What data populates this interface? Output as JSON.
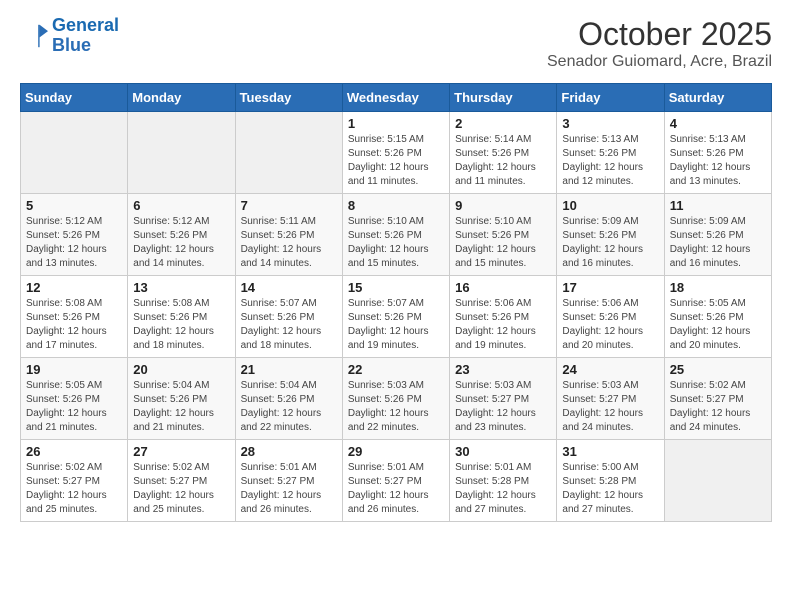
{
  "header": {
    "logo_line1": "General",
    "logo_line2": "Blue",
    "month": "October 2025",
    "location": "Senador Guiomard, Acre, Brazil"
  },
  "weekdays": [
    "Sunday",
    "Monday",
    "Tuesday",
    "Wednesday",
    "Thursday",
    "Friday",
    "Saturday"
  ],
  "weeks": [
    [
      {
        "day": "",
        "info": ""
      },
      {
        "day": "",
        "info": ""
      },
      {
        "day": "",
        "info": ""
      },
      {
        "day": "1",
        "info": "Sunrise: 5:15 AM\nSunset: 5:26 PM\nDaylight: 12 hours\nand 11 minutes."
      },
      {
        "day": "2",
        "info": "Sunrise: 5:14 AM\nSunset: 5:26 PM\nDaylight: 12 hours\nand 11 minutes."
      },
      {
        "day": "3",
        "info": "Sunrise: 5:13 AM\nSunset: 5:26 PM\nDaylight: 12 hours\nand 12 minutes."
      },
      {
        "day": "4",
        "info": "Sunrise: 5:13 AM\nSunset: 5:26 PM\nDaylight: 12 hours\nand 13 minutes."
      }
    ],
    [
      {
        "day": "5",
        "info": "Sunrise: 5:12 AM\nSunset: 5:26 PM\nDaylight: 12 hours\nand 13 minutes."
      },
      {
        "day": "6",
        "info": "Sunrise: 5:12 AM\nSunset: 5:26 PM\nDaylight: 12 hours\nand 14 minutes."
      },
      {
        "day": "7",
        "info": "Sunrise: 5:11 AM\nSunset: 5:26 PM\nDaylight: 12 hours\nand 14 minutes."
      },
      {
        "day": "8",
        "info": "Sunrise: 5:10 AM\nSunset: 5:26 PM\nDaylight: 12 hours\nand 15 minutes."
      },
      {
        "day": "9",
        "info": "Sunrise: 5:10 AM\nSunset: 5:26 PM\nDaylight: 12 hours\nand 15 minutes."
      },
      {
        "day": "10",
        "info": "Sunrise: 5:09 AM\nSunset: 5:26 PM\nDaylight: 12 hours\nand 16 minutes."
      },
      {
        "day": "11",
        "info": "Sunrise: 5:09 AM\nSunset: 5:26 PM\nDaylight: 12 hours\nand 16 minutes."
      }
    ],
    [
      {
        "day": "12",
        "info": "Sunrise: 5:08 AM\nSunset: 5:26 PM\nDaylight: 12 hours\nand 17 minutes."
      },
      {
        "day": "13",
        "info": "Sunrise: 5:08 AM\nSunset: 5:26 PM\nDaylight: 12 hours\nand 18 minutes."
      },
      {
        "day": "14",
        "info": "Sunrise: 5:07 AM\nSunset: 5:26 PM\nDaylight: 12 hours\nand 18 minutes."
      },
      {
        "day": "15",
        "info": "Sunrise: 5:07 AM\nSunset: 5:26 PM\nDaylight: 12 hours\nand 19 minutes."
      },
      {
        "day": "16",
        "info": "Sunrise: 5:06 AM\nSunset: 5:26 PM\nDaylight: 12 hours\nand 19 minutes."
      },
      {
        "day": "17",
        "info": "Sunrise: 5:06 AM\nSunset: 5:26 PM\nDaylight: 12 hours\nand 20 minutes."
      },
      {
        "day": "18",
        "info": "Sunrise: 5:05 AM\nSunset: 5:26 PM\nDaylight: 12 hours\nand 20 minutes."
      }
    ],
    [
      {
        "day": "19",
        "info": "Sunrise: 5:05 AM\nSunset: 5:26 PM\nDaylight: 12 hours\nand 21 minutes."
      },
      {
        "day": "20",
        "info": "Sunrise: 5:04 AM\nSunset: 5:26 PM\nDaylight: 12 hours\nand 21 minutes."
      },
      {
        "day": "21",
        "info": "Sunrise: 5:04 AM\nSunset: 5:26 PM\nDaylight: 12 hours\nand 22 minutes."
      },
      {
        "day": "22",
        "info": "Sunrise: 5:03 AM\nSunset: 5:26 PM\nDaylight: 12 hours\nand 22 minutes."
      },
      {
        "day": "23",
        "info": "Sunrise: 5:03 AM\nSunset: 5:27 PM\nDaylight: 12 hours\nand 23 minutes."
      },
      {
        "day": "24",
        "info": "Sunrise: 5:03 AM\nSunset: 5:27 PM\nDaylight: 12 hours\nand 24 minutes."
      },
      {
        "day": "25",
        "info": "Sunrise: 5:02 AM\nSunset: 5:27 PM\nDaylight: 12 hours\nand 24 minutes."
      }
    ],
    [
      {
        "day": "26",
        "info": "Sunrise: 5:02 AM\nSunset: 5:27 PM\nDaylight: 12 hours\nand 25 minutes."
      },
      {
        "day": "27",
        "info": "Sunrise: 5:02 AM\nSunset: 5:27 PM\nDaylight: 12 hours\nand 25 minutes."
      },
      {
        "day": "28",
        "info": "Sunrise: 5:01 AM\nSunset: 5:27 PM\nDaylight: 12 hours\nand 26 minutes."
      },
      {
        "day": "29",
        "info": "Sunrise: 5:01 AM\nSunset: 5:27 PM\nDaylight: 12 hours\nand 26 minutes."
      },
      {
        "day": "30",
        "info": "Sunrise: 5:01 AM\nSunset: 5:28 PM\nDaylight: 12 hours\nand 27 minutes."
      },
      {
        "day": "31",
        "info": "Sunrise: 5:00 AM\nSunset: 5:28 PM\nDaylight: 12 hours\nand 27 minutes."
      },
      {
        "day": "",
        "info": ""
      }
    ]
  ]
}
